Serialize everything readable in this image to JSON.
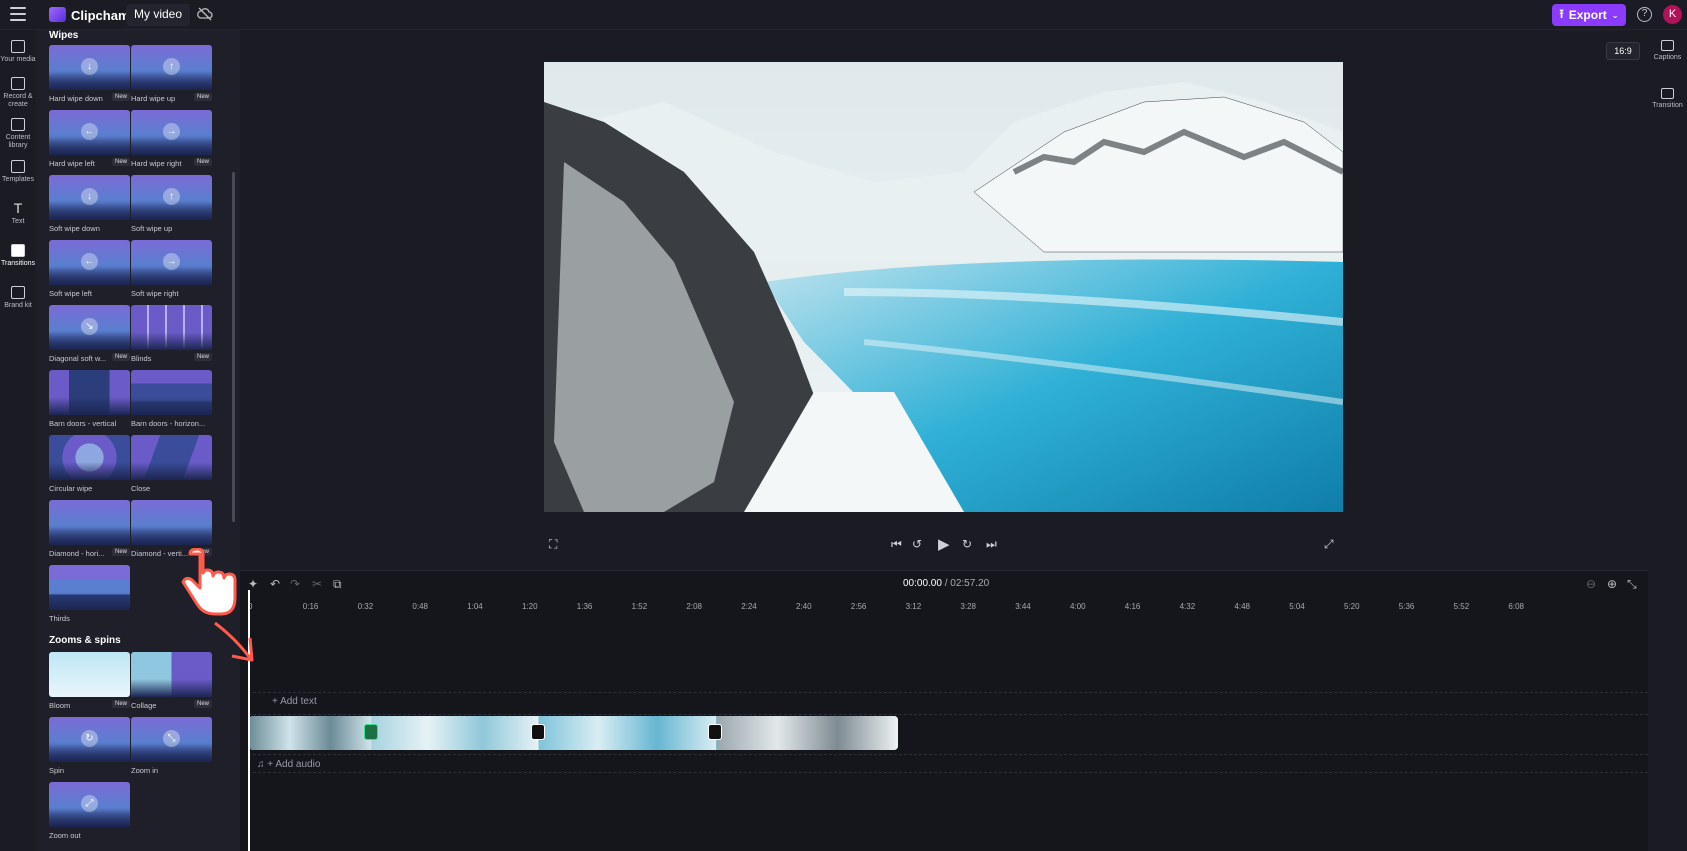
{
  "app": {
    "brand": "Clipchamp",
    "project_name": "My video"
  },
  "toolbar": {
    "export_label": "Export",
    "avatar_initial": "K",
    "aspect_ratio": "16:9"
  },
  "left_nav": [
    {
      "label": "Your media",
      "icon": "folder-icon"
    },
    {
      "label": "Record & create",
      "icon": "camera-icon"
    },
    {
      "label": "Content library",
      "icon": "library-icon"
    },
    {
      "label": "Templates",
      "icon": "templates-icon"
    },
    {
      "label": "Text",
      "icon": "text-icon"
    },
    {
      "label": "Transitions",
      "icon": "transitions-icon"
    },
    {
      "label": "Brand kit",
      "icon": "brand-kit-icon"
    }
  ],
  "panel": {
    "section_wipes": "Wipes",
    "section_zooms": "Zooms & spins",
    "new_badge": "New",
    "wipes": [
      {
        "label": "Hard wipe down",
        "new": true,
        "arrow": "↓"
      },
      {
        "label": "Hard wipe up",
        "new": true,
        "arrow": "↑"
      },
      {
        "label": "Hard wipe left",
        "new": true,
        "arrow": "←"
      },
      {
        "label": "Hard wipe right",
        "new": true,
        "arrow": "→"
      },
      {
        "label": "Soft wipe down",
        "new": false,
        "arrow": "↓"
      },
      {
        "label": "Soft wipe up",
        "new": false,
        "arrow": "↑"
      },
      {
        "label": "Soft wipe left",
        "new": false,
        "arrow": "←"
      },
      {
        "label": "Soft wipe right",
        "new": false,
        "arrow": "→"
      },
      {
        "label": "Diagonal soft w...",
        "new": true,
        "arrow": "↘"
      },
      {
        "label": "Blinds",
        "new": true,
        "arrow": ""
      },
      {
        "label": "Barn doors - vertical",
        "new": false,
        "arrow": ""
      },
      {
        "label": "Barn doors - horizon...",
        "new": false,
        "arrow": ""
      },
      {
        "label": "Circular wipe",
        "new": false,
        "arrow": ""
      },
      {
        "label": "Close",
        "new": false,
        "arrow": ""
      },
      {
        "label": "Diamond - hori...",
        "new": true,
        "arrow": ""
      },
      {
        "label": "Diamond - verti...",
        "new": true,
        "arrow": ""
      },
      {
        "label": "Thirds",
        "new": false,
        "arrow": ""
      }
    ],
    "zooms": [
      {
        "label": "Bloom",
        "new": true,
        "arrow": ""
      },
      {
        "label": "Collage",
        "new": true,
        "arrow": ""
      },
      {
        "label": "Spin",
        "new": false,
        "arrow": "↻"
      },
      {
        "label": "Zoom in",
        "new": false,
        "arrow": "⤡"
      },
      {
        "label": "Zoom out",
        "new": false,
        "arrow": "⤢"
      }
    ]
  },
  "right_bar": [
    {
      "label": "Captions",
      "icon": "captions-icon"
    },
    {
      "label": "Transition",
      "icon": "transition-icon"
    }
  ],
  "timeline": {
    "current_time": "00:00.00",
    "total_time": "/ 02:57.20",
    "ruler": [
      "0",
      "0:16",
      "0:32",
      "0:48",
      "1:04",
      "1:20",
      "1:36",
      "1:52",
      "2:08",
      "2:24",
      "2:40",
      "2:56",
      "3:12",
      "3:28",
      "3:44",
      "4:00",
      "4:16",
      "4:32",
      "4:48",
      "5:04",
      "5:20",
      "5:36",
      "5:52",
      "6:08"
    ],
    "add_text": "+ Add text",
    "add_audio": "+ Add audio"
  }
}
